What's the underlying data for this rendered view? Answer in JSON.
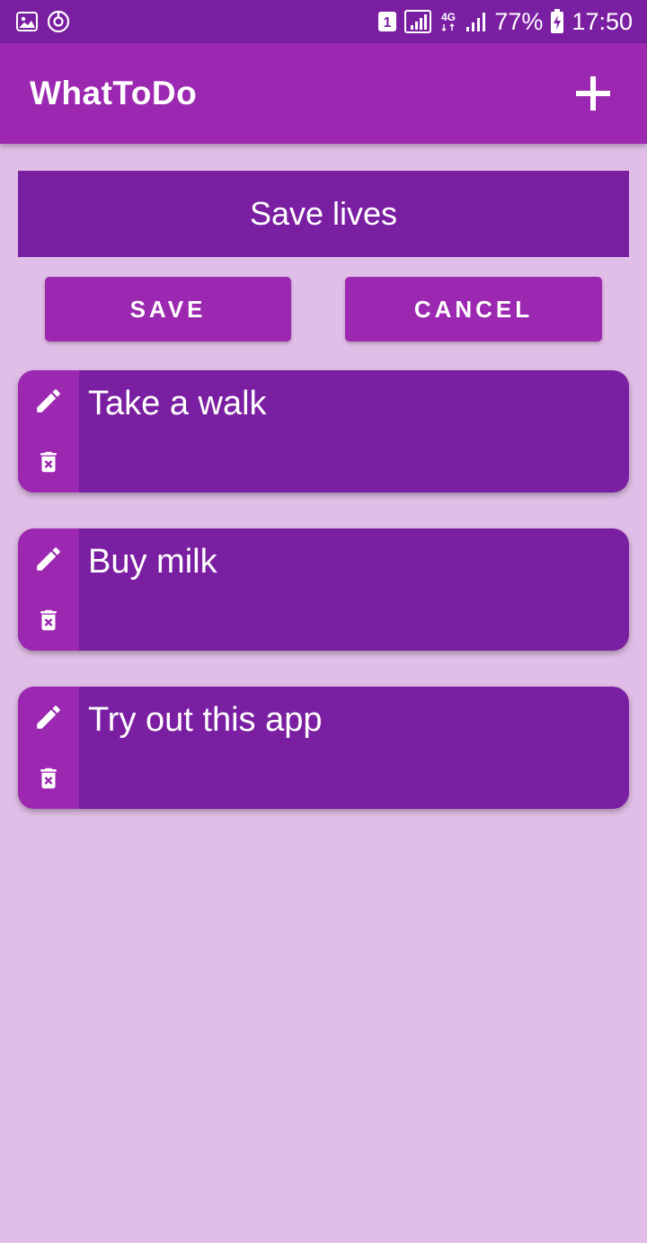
{
  "status_bar": {
    "sim_badge": "1",
    "network": "4G",
    "battery": "77%",
    "time": "17:50",
    "icons": [
      "gallery-icon",
      "sync-icon",
      "sim-icon",
      "signal-icon",
      "network-4g-icon",
      "signal-icon",
      "battery-charging-icon"
    ]
  },
  "app_bar": {
    "title": "WhatToDo",
    "add_icon": "plus-icon"
  },
  "editor": {
    "value": "Save lives"
  },
  "buttons": {
    "save_label": "SAVE",
    "cancel_label": "CANCEL"
  },
  "todos": [
    {
      "text": "Take a walk"
    },
    {
      "text": "Buy milk"
    },
    {
      "text": "Try out this app"
    }
  ],
  "colors": {
    "background": "#e1bee7",
    "primary": "#9c27b0",
    "primary_dark": "#7b1fa2",
    "text": "#ffffff"
  }
}
